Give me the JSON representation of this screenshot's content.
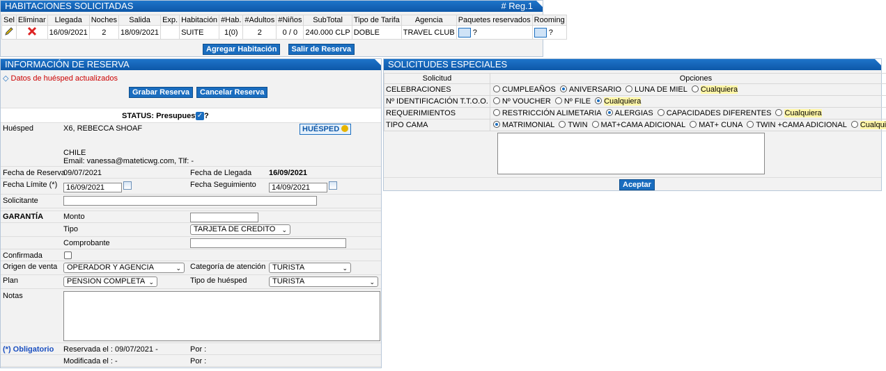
{
  "habitaciones": {
    "title": "HABITACIONES SOLICITADAS",
    "reg": "# Reg.1",
    "headers": [
      "Sel",
      "Eliminar",
      "Llegada",
      "Noches",
      "Salida",
      "Exp.",
      "Habitación",
      "#Hab.",
      "#Adultos",
      "#Niños",
      "SubTotal",
      "Tipo de Tarifa",
      "Agencia",
      "Paquetes reservados",
      "Rooming"
    ],
    "row": {
      "llegada": "16/09/2021",
      "noches": "2",
      "salida": "18/09/2021",
      "exp": "",
      "habitacion": "SUITE",
      "hab": "1(0)",
      "adultos": "2",
      "ninos": "0 / 0",
      "subtotal": "240.000 CLP",
      "tarifa": "DOBLE",
      "agencia": "TRAVEL CLUB",
      "paq_q": "?",
      "rooming_q": "?"
    },
    "btn_agregar": "Agregar Habitación",
    "btn_salir": "Salir de Reserva"
  },
  "reserva": {
    "title": "INFORMACIÓN DE RESERVA",
    "notice": "Datos de huésped actualizados",
    "btn_grabar": "Grabar Reserva",
    "btn_cancelar": "Cancelar Reserva",
    "status": "STATUS: Presupuesto",
    "status_q": "?",
    "huesped_label": "Huésped",
    "huesped_name": "X6, REBECCA SHOAF",
    "huesped_country": "CHILE",
    "huesped_contact": "Email: vanessa@mateticwg.com, Tlf: -",
    "huesped_btn": "HUÉSPED",
    "fecha_reserva_label": "Fecha de Reserva",
    "fecha_reserva": "09/07/2021",
    "fecha_llegada_label": "Fecha de Llegada",
    "fecha_llegada": "16/09/2021",
    "fecha_limite_label": "Fecha Límite (*)",
    "fecha_limite": "16/09/2021",
    "fecha_seg_label": "Fecha Seguimiento",
    "fecha_seg": "14/09/2021",
    "solicitante_label": "Solicitante",
    "solicitante": "",
    "garantia_label": "GARANTÍA",
    "monto_label": "Monto",
    "monto": "",
    "tipo_label": "Tipo",
    "tipo": "TARJETA DE CREDITO",
    "comprobante_label": "Comprobante",
    "comprobante": "",
    "confirmada_label": "Confirmada",
    "origen_label": "Origen de venta",
    "origen": "OPERADOR Y AGENCIA",
    "categoria_label": "Categoría de atención",
    "categoria": "TURISTA",
    "plan_label": "Plan",
    "plan": "PENSION COMPLETA",
    "tipo_huesped_label": "Tipo de huésped",
    "tipo_huesped": "TURISTA",
    "notas_label": "Notas",
    "notas": "",
    "obligatorio": "(*) Obligatorio",
    "reservada": "Reservada el : 09/07/2021 -",
    "por1": "Por :",
    "modificada": "Modificada el : -",
    "por2": "Por :"
  },
  "solicitudes": {
    "title": "SOLICITUDES ESPECIALES",
    "col_solicitud": "Solicitud",
    "col_opciones": "Opciones",
    "rows": [
      {
        "name": "CELEBRACIONES",
        "options": [
          "CUMPLEAÑOS",
          "ANIVERSARIO",
          "LUNA DE MIEL",
          "Cualquiera"
        ],
        "selected": 1
      },
      {
        "name": "Nº IDENTIFICACIÓN T.T.O.O.",
        "options": [
          "Nº VOUCHER",
          "Nº FILE",
          "Cualquiera"
        ],
        "selected": 2
      },
      {
        "name": "REQUERIMIENTOS",
        "options": [
          "RESTRICCIÓN ALIMETARIA",
          "ALERGIAS",
          "CAPACIDADES DIFERENTES",
          "Cualquiera"
        ],
        "selected": 1
      },
      {
        "name": "TIPO CAMA",
        "options": [
          "MATRIMONIAL",
          "TWIN",
          "MAT+CAMA ADICIONAL",
          "MAT+ CUNA",
          "TWIN +CAMA ADICIONAL",
          "Cualquiera"
        ],
        "selected": 0
      }
    ],
    "comment": "",
    "btn_aceptar": "Aceptar"
  }
}
